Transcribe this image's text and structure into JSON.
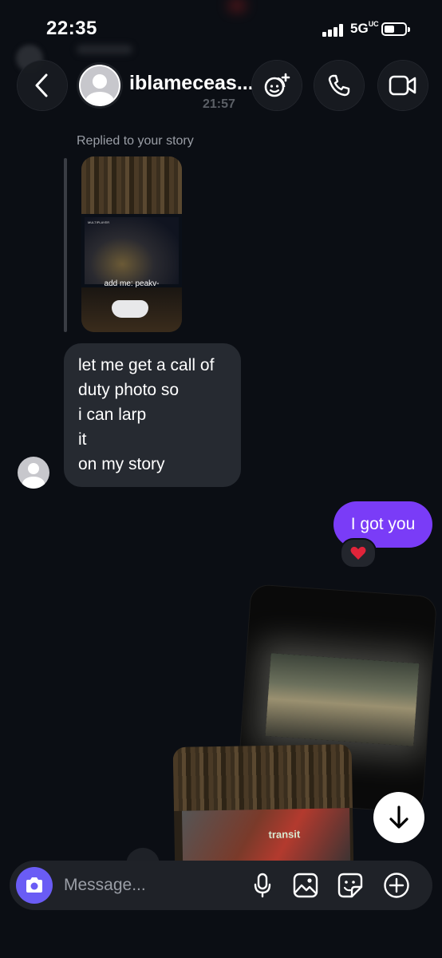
{
  "status_bar": {
    "time": "22:35",
    "network": "5G",
    "network_sub": "UC"
  },
  "header": {
    "username": "iblameceas...",
    "time": "21:57"
  },
  "story_reply": {
    "label": "Replied to your story",
    "caption": "add me: peakv-"
  },
  "messages": {
    "incoming": {
      "lines": [
        "let me get a call of",
        "duty photo so",
        "i can larp",
        "it",
        "on my story"
      ]
    },
    "outgoing": {
      "text": "I got you",
      "reaction": "❤️"
    }
  },
  "photo2": {
    "text": "transit"
  },
  "composer": {
    "placeholder": "Message..."
  },
  "colors": {
    "accent": "#7a3cf7",
    "camera": "#6a5cf5",
    "background": "#0b0e14",
    "bubble_in": "#262a31"
  },
  "icons": [
    "chevron-left-icon",
    "effects-icon",
    "phone-icon",
    "video-icon",
    "camera-icon",
    "mic-icon",
    "gallery-icon",
    "sticker-icon",
    "plus-icon",
    "arrow-down-icon",
    "heart-icon"
  ]
}
